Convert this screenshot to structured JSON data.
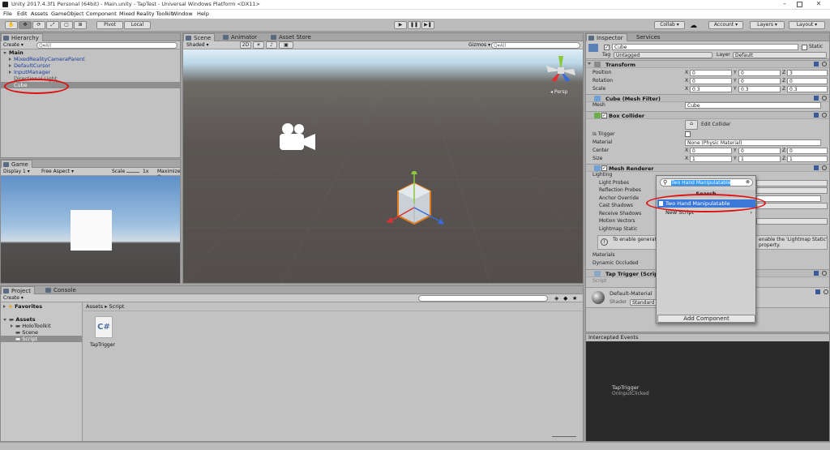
{
  "window": {
    "title": "Unity 2017.4.3f1 Personal (64bit) - Main.unity - TapTest - Universal Windows Platform <DX11>"
  },
  "menu": [
    "File",
    "Edit",
    "Assets",
    "GameObject",
    "Component",
    "Mixed Reality Toolkit",
    "Window",
    "Help"
  ],
  "toolbar": {
    "pivot": "Pivot",
    "local": "Local",
    "collab": "Collab ▾",
    "account": "Account",
    "layers": "Layers",
    "layout": "Layout"
  },
  "hierarchy": {
    "tab": "Hierarchy",
    "create": "Create",
    "search_placeholder": "Q▾All",
    "scene": "Main",
    "items": [
      "MixedRealityCameraParent",
      "DefaultCursor",
      "InputManager",
      "Directional Light",
      "Cube"
    ]
  },
  "scene_view": {
    "tabs": [
      "Scene",
      "Animator",
      "Asset Store"
    ],
    "shading": "Shaded",
    "mode2d": "2D",
    "gizmos": "Gizmos ▾",
    "search": "Q▾All",
    "persp": "◂ Persp"
  },
  "game_view": {
    "tab": "Game",
    "display": "Display 1",
    "aspect": "Free Aspect",
    "scale_label": "Scale",
    "scale_value": "1x",
    "maximize": "Maximize O"
  },
  "project": {
    "tabs": [
      "Project",
      "Console"
    ],
    "create": "Create",
    "favorites": "Favorites",
    "assets": "Assets",
    "folders": [
      "HoloToolkit",
      "Scene",
      "Script"
    ],
    "breadcrumb": "Assets ▸ Script",
    "file": "TapTrigger"
  },
  "inspector": {
    "tabs": [
      "Inspector",
      "Services"
    ],
    "name": "Cube",
    "static": "Static",
    "tag_label": "Tag",
    "tag": "Untagged",
    "layer_label": "Layer",
    "layer": "Default",
    "transform": {
      "title": "Transform",
      "rows": [
        {
          "label": "Position",
          "x": "0",
          "y": "0",
          "z": "3"
        },
        {
          "label": "Rotation",
          "x": "0",
          "y": "0",
          "z": "0"
        },
        {
          "label": "Scale",
          "x": "0.3",
          "y": "0.3",
          "z": "0.3"
        }
      ]
    },
    "mesh_filter": {
      "title": "Cube (Mesh Filter)",
      "mesh_label": "Mesh",
      "mesh": "Cube"
    },
    "box_collider": {
      "title": "Box Collider",
      "edit": "Edit Collider",
      "is_trigger": "Is Trigger",
      "material_label": "Material",
      "material": "None (Physic Material)",
      "center": {
        "label": "Center",
        "x": "0",
        "y": "0",
        "z": "0"
      },
      "size": {
        "label": "Size",
        "x": "1",
        "y": "1",
        "z": "1"
      }
    },
    "mesh_renderer": {
      "title": "Mesh Renderer",
      "lighting": "Lighting",
      "rows": [
        "Light Probes",
        "Reflection Probes",
        "Anchor Override",
        "Cast Shadows",
        "Receive Shadows",
        "Motion Vectors",
        "Lightmap Static"
      ],
      "info_left": "To enable generatio",
      "info_right": "enable the 'Lightmap Static'",
      "info_tail": "property.",
      "materials": "Materials",
      "dynamic": "Dynamic Occluded"
    },
    "tap_trigger": {
      "title": "Tap Trigger (Scrip",
      "script_label": "Script"
    },
    "material": {
      "name": "Default-Material",
      "shader_label": "Shader",
      "shader": "Standard"
    }
  },
  "popup": {
    "search": "Two Hand Manipulatable",
    "header": "Search",
    "result": "Two Hand Manipulatable",
    "new_script": "New Script",
    "add_component": "Add Component"
  },
  "events": {
    "title": "Intercepted Events",
    "name": "TapTrigger",
    "detail": "OnInputClicked"
  },
  "colors": {
    "accent": "#3b78d8",
    "highlight": "#d11111"
  }
}
